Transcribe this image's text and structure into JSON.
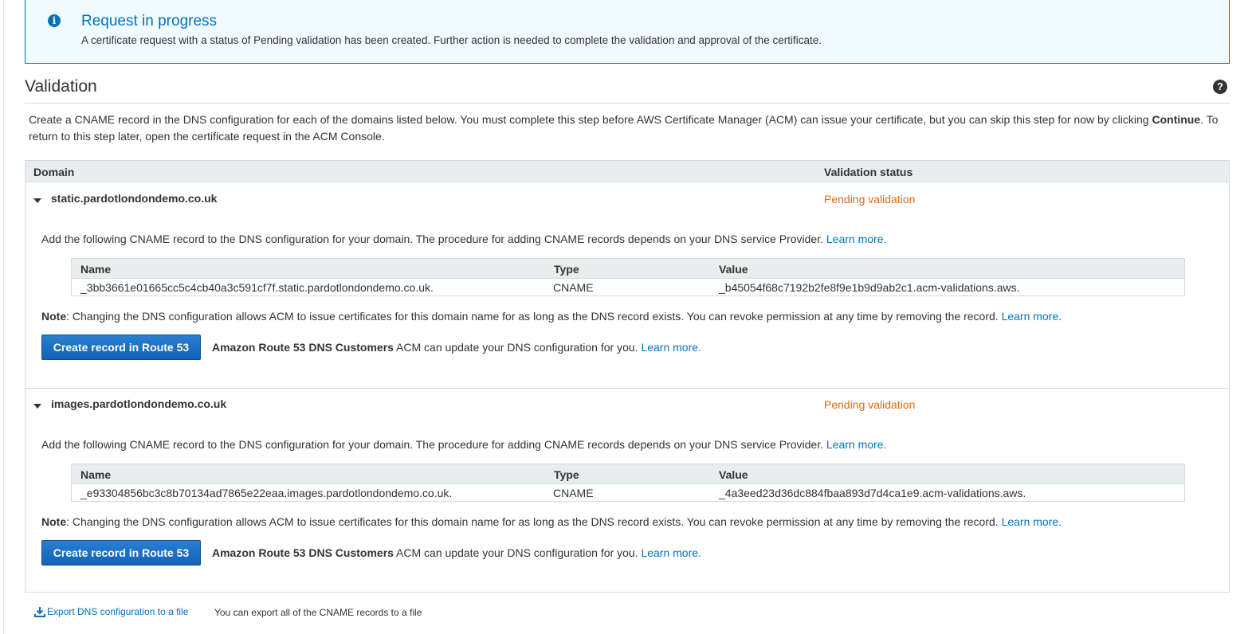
{
  "info": {
    "title": "Request in progress",
    "message": "A certificate request with a status of Pending validation has been created. Further action is needed to complete the validation and approval of the certificate.",
    "icon": "info-icon"
  },
  "validation": {
    "title": "Validation",
    "help_icon": "?",
    "description_pre": "Create a CNAME record in the DNS configuration for each of the domains listed below. You must complete this step before AWS Certificate Manager (ACM) can issue your certificate, but you can skip this step for now by clicking ",
    "description_bold": "Continue",
    "description_post": ". To return to this step later, open the certificate request in the ACM Console."
  },
  "table": {
    "headers": {
      "domain": "Domain",
      "status": "Validation status"
    },
    "rows": [
      {
        "domain": "static.pardotlondondemo.co.uk",
        "status": "Pending validation",
        "instruction": "Add the following CNAME record to the DNS configuration for your domain. The procedure for adding CNAME records depends on your DNS service Provider. ",
        "learn_more": "Learn more.",
        "cname": {
          "headers": {
            "name": "Name",
            "type": "Type",
            "value": "Value"
          },
          "name": "_3bb3661e01665cc5c4cb40a3c591cf7f.static.pardotlondondemo.co.uk.",
          "type": "CNAME",
          "value": "_b45054f68c7192b2fe8f9e1b9d9ab2c1.acm-validations.aws."
        },
        "note_label": "Note",
        "note_text": ": Changing the DNS configuration allows ACM to issue certificates for this domain name for as long as the DNS record exists. You can revoke permission at any time by removing the record. ",
        "note_link": "Learn more.",
        "button": "Create record in Route 53",
        "r53_bold": "Amazon Route 53 DNS Customers",
        "r53_text": " ACM can update your DNS configuration for you. ",
        "r53_link": "Learn more."
      },
      {
        "domain": "images.pardotlondondemo.co.uk",
        "status": "Pending validation",
        "instruction": "Add the following CNAME record to the DNS configuration for your domain. The procedure for adding CNAME records depends on your DNS service Provider. ",
        "learn_more": "Learn more.",
        "cname": {
          "headers": {
            "name": "Name",
            "type": "Type",
            "value": "Value"
          },
          "name": "_e93304856bc3c8b70134ad7865e22eaa.images.pardotlondondemo.co.uk.",
          "type": "CNAME",
          "value": "_4a3eed23d36dc884fbaa893d7d4ca1e9.acm-validations.aws."
        },
        "note_label": "Note",
        "note_text": ": Changing the DNS configuration allows ACM to issue certificates for this domain name for as long as the DNS record exists. You can revoke permission at any time by removing the record. ",
        "note_link": "Learn more.",
        "button": "Create record in Route 53",
        "r53_bold": "Amazon Route 53 DNS Customers",
        "r53_text": " ACM can update your DNS configuration for you. ",
        "r53_link": "Learn more."
      }
    ]
  },
  "export": {
    "link": "Export DNS configuration to a file",
    "note": "You can export all of the CNAME records to a file",
    "icon": "download-icon"
  },
  "colors": {
    "accent": "#0073bb",
    "pending": "#dd6b10",
    "info_bg": "#f1faff",
    "button": "#1063b8"
  }
}
